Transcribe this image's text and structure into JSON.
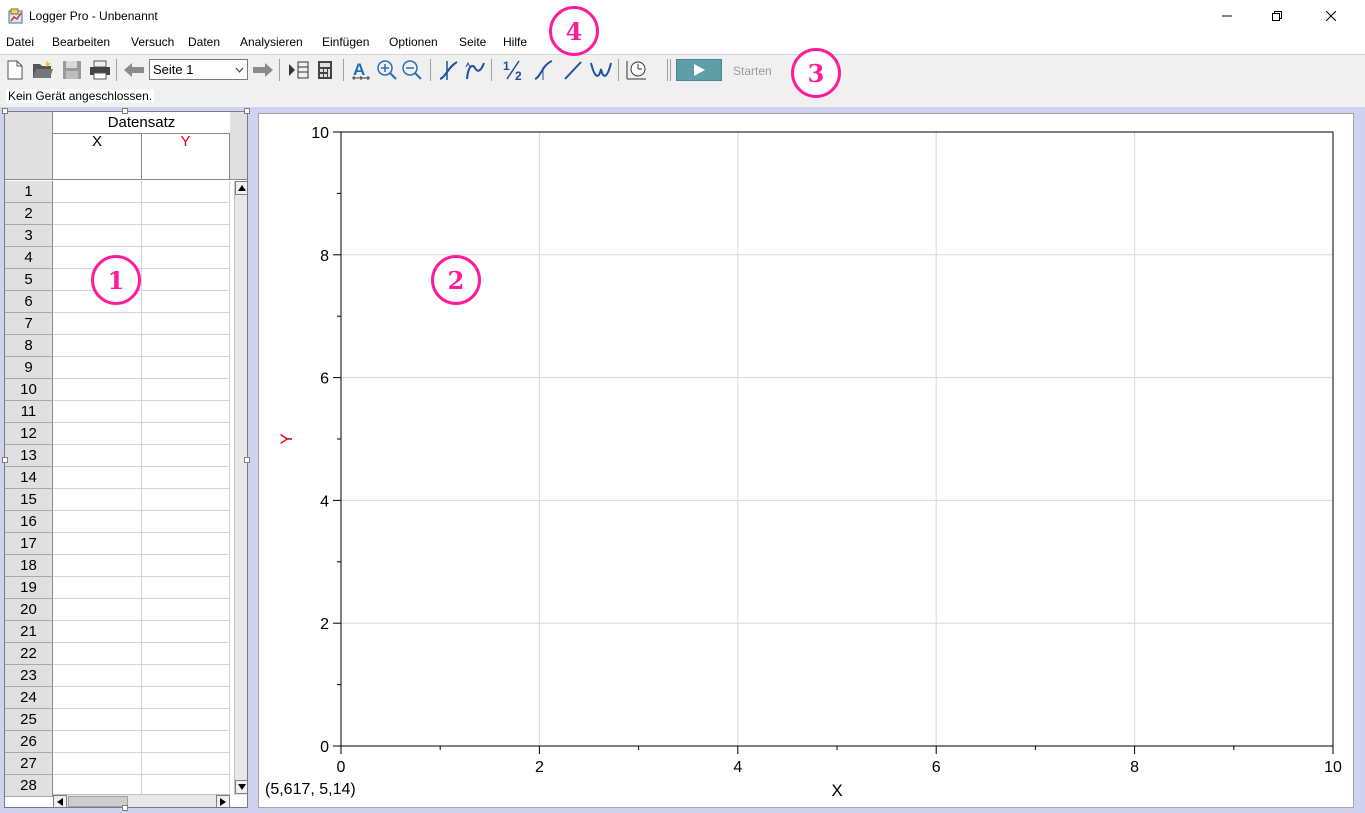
{
  "window": {
    "title": "Logger Pro - Unbenannt",
    "icon": "logger-pro-app-icon",
    "controls": [
      "minimize-icon",
      "restore-icon",
      "close-icon"
    ]
  },
  "menu": {
    "items": [
      "Datei",
      "Bearbeiten",
      "Versuch",
      "Daten",
      "Analysieren",
      "Einfügen",
      "Optionen",
      "Seite",
      "Hilfe"
    ]
  },
  "toolbar": {
    "page_select": "Seite 1",
    "collect_label": "Starten",
    "collect_color": "#5f9ea6"
  },
  "status": {
    "sensor_text": "Kein Gerät angeschlossen."
  },
  "table": {
    "dataset": "Datensatz",
    "col_x": "X",
    "col_y": "Y",
    "col_y_color": "#e8001c",
    "rows": [
      "1",
      "2",
      "3",
      "4",
      "5",
      "6",
      "7",
      "8",
      "9",
      "10",
      "11",
      "12",
      "13",
      "14",
      "15",
      "16",
      "17",
      "18",
      "19",
      "20",
      "21",
      "22",
      "23",
      "24",
      "25",
      "26",
      "27",
      "28"
    ]
  },
  "graph": {
    "coord_readout": "(5,617, 5,14)"
  },
  "chart_data": {
    "type": "scatter",
    "title": "",
    "xlabel": "X",
    "ylabel": "Y",
    "ylabel_color": "#e8001c",
    "xlim": [
      0,
      10
    ],
    "ylim": [
      0,
      10
    ],
    "x_ticks": [
      0,
      2,
      4,
      6,
      8,
      10
    ],
    "y_ticks": [
      0,
      2,
      4,
      6,
      8,
      10
    ],
    "grid": true,
    "series": []
  },
  "callouts": [
    "1",
    "2",
    "3",
    "4"
  ]
}
